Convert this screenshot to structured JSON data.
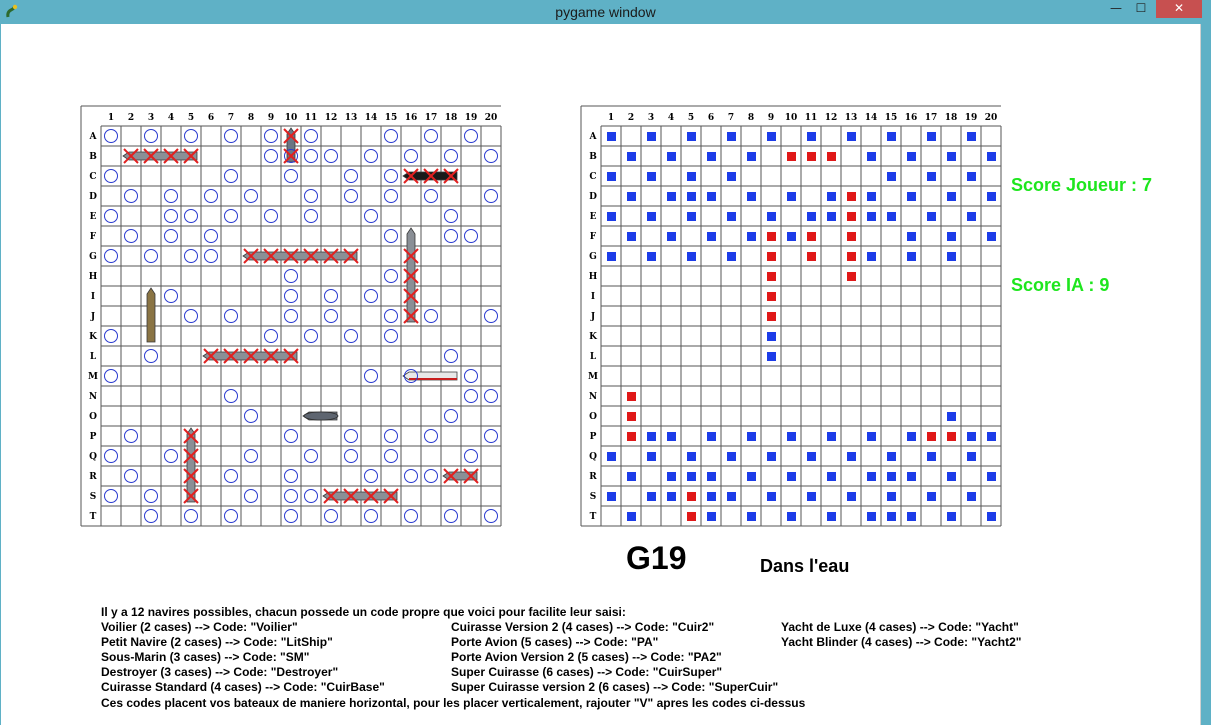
{
  "window": {
    "title": "pygame window",
    "minimize_glyph": "—",
    "maximize_glyph": "☐",
    "close_glyph": "✕",
    "frame_color": "#5fb1c6",
    "close_color": "#c75050"
  },
  "board": {
    "columns": [
      "1",
      "2",
      "3",
      "4",
      "5",
      "6",
      "7",
      "8",
      "9",
      "10",
      "11",
      "12",
      "13",
      "14",
      "15",
      "16",
      "17",
      "18",
      "19",
      "20"
    ],
    "rows": [
      "A",
      "B",
      "C",
      "D",
      "E",
      "F",
      "G",
      "H",
      "I",
      "J",
      "K",
      "L",
      "M",
      "N",
      "O",
      "P",
      "Q",
      "R",
      "S",
      "T"
    ]
  },
  "player_board": {
    "name": "player-board",
    "miss_marker": "blue-circle",
    "hit_marker": "red-cross",
    "misses": [
      "A1",
      "A3",
      "A5",
      "A7",
      "A9",
      "A11",
      "A15",
      "A17",
      "A19",
      "B9",
      "B10",
      "B11",
      "B12",
      "B14",
      "B16",
      "B18",
      "B20",
      "C1",
      "C7",
      "C10",
      "C13",
      "C15",
      "D2",
      "D4",
      "D6",
      "D8",
      "D11",
      "D13",
      "D15",
      "D17",
      "D20",
      "E1",
      "E4",
      "E5",
      "E7",
      "E9",
      "E11",
      "E14",
      "E18",
      "F2",
      "F4",
      "F6",
      "F15",
      "F18",
      "F19",
      "G1",
      "G3",
      "G5",
      "G6",
      "H10",
      "H15",
      "I4",
      "I10",
      "I12",
      "I14",
      "J5",
      "J7",
      "J10",
      "J12",
      "J15",
      "J17",
      "J20",
      "K1",
      "K9",
      "K11",
      "K13",
      "K15",
      "L3",
      "L18",
      "M1",
      "M14",
      "M16",
      "M19",
      "N7",
      "N19",
      "N20",
      "O8",
      "O18",
      "P2",
      "P10",
      "P13",
      "P15",
      "P17",
      "P20",
      "Q1",
      "Q4",
      "Q8",
      "Q11",
      "Q13",
      "Q15",
      "Q19",
      "R2",
      "R7",
      "R10",
      "R14",
      "R16",
      "R17",
      "S1",
      "S3",
      "S8",
      "S10",
      "S11",
      "T3",
      "T5",
      "T7",
      "T10",
      "T12",
      "T14",
      "T16",
      "T18",
      "T20"
    ],
    "hits": [
      "A10",
      "B2",
      "B3",
      "B4",
      "B5",
      "B10",
      "C16",
      "C17",
      "C18",
      "G8",
      "G9",
      "G10",
      "G11",
      "G12",
      "G13",
      "G16",
      "H16",
      "I16",
      "J16",
      "L6",
      "L7",
      "L8",
      "L9",
      "L10",
      "P5",
      "Q5",
      "R5",
      "S5",
      "R18",
      "R19",
      "S12",
      "S13",
      "S14",
      "S15"
    ],
    "ships": [
      {
        "name": "vertical-ship-col10",
        "icon": "navy-ship-icon",
        "cells": [
          "A10",
          "B10"
        ]
      },
      {
        "name": "horizontal-ship-row-b",
        "icon": "gray-ship-icon",
        "cells": [
          "B2",
          "B3",
          "B4",
          "B5"
        ]
      },
      {
        "name": "black-destroyer",
        "icon": "black-ship-icon",
        "cells": [
          "C16",
          "C17",
          "C18"
        ]
      },
      {
        "name": "horizontal-ship-row-g",
        "icon": "gray-ship-icon",
        "cells": [
          "G8",
          "G9",
          "G10",
          "G11",
          "G12",
          "G13"
        ]
      },
      {
        "name": "vertical-ship-col16",
        "icon": "gray-ship-icon",
        "cells": [
          "F16",
          "G16",
          "H16",
          "I16",
          "J16"
        ]
      },
      {
        "name": "brown-sailboat",
        "icon": "sailboat-icon",
        "cells": [
          "I3",
          "J3",
          "K3"
        ]
      },
      {
        "name": "horizontal-ship-row-l",
        "icon": "gray-ship-icon",
        "cells": [
          "L6",
          "L7",
          "L8",
          "L9",
          "L10"
        ]
      },
      {
        "name": "red-yacht",
        "icon": "yacht-icon",
        "cells": [
          "M16",
          "M17",
          "M18"
        ]
      },
      {
        "name": "submarine",
        "icon": "submarine-icon",
        "cells": [
          "O11",
          "O12"
        ]
      },
      {
        "name": "vertical-ship-col5",
        "icon": "gray-ship-icon",
        "cells": [
          "P5",
          "Q5",
          "R5",
          "S5"
        ]
      },
      {
        "name": "small-ship-row-r",
        "icon": "gray-ship-icon",
        "cells": [
          "R18",
          "R19"
        ]
      },
      {
        "name": "horizontal-ship-row-s",
        "icon": "gray-ship-icon",
        "cells": [
          "S12",
          "S13",
          "S14",
          "S15"
        ]
      }
    ]
  },
  "ia_board": {
    "name": "ia-board",
    "miss_marker": "blue-square",
    "hit_marker": "red-square",
    "misses": [
      "A1",
      "A3",
      "A5",
      "A7",
      "A9",
      "A11",
      "A13",
      "A15",
      "A17",
      "A19",
      "B2",
      "B4",
      "B6",
      "B8",
      "B14",
      "B16",
      "B18",
      "B20",
      "C1",
      "C3",
      "C5",
      "C7",
      "C15",
      "C17",
      "C19",
      "D2",
      "D4",
      "D5",
      "D6",
      "D8",
      "D10",
      "D12",
      "D14",
      "D16",
      "D18",
      "D20",
      "E1",
      "E3",
      "E5",
      "E7",
      "E9",
      "E11",
      "E12",
      "E14",
      "E15",
      "E17",
      "E19",
      "F2",
      "F4",
      "F6",
      "F8",
      "F10",
      "F16",
      "F18",
      "F20",
      "G1",
      "G3",
      "G5",
      "G7",
      "G14",
      "G16",
      "G18",
      "K9",
      "L9",
      "O18",
      "P3",
      "P4",
      "P6",
      "P8",
      "P10",
      "P12",
      "P14",
      "P16",
      "P19",
      "P20",
      "Q1",
      "Q3",
      "Q5",
      "Q7",
      "Q9",
      "Q11",
      "Q13",
      "Q15",
      "Q17",
      "Q19",
      "R2",
      "R4",
      "R5",
      "R6",
      "R8",
      "R10",
      "R12",
      "R14",
      "R15",
      "R16",
      "R18",
      "R20",
      "S1",
      "S3",
      "S4",
      "S6",
      "S7",
      "S9",
      "S11",
      "S13",
      "S15",
      "S17",
      "S19",
      "T2",
      "T6",
      "T8",
      "T10",
      "T12",
      "T14",
      "T15",
      "T16",
      "T18",
      "T20"
    ],
    "hits": [
      "B10",
      "B11",
      "B12",
      "D13",
      "E13",
      "F9",
      "F11",
      "F13",
      "G9",
      "G11",
      "G13",
      "H9",
      "H13",
      "I9",
      "J9",
      "N2",
      "O2",
      "P2",
      "P17",
      "P18",
      "S5",
      "T5"
    ]
  },
  "scores": {
    "player_label": "Score Joueur : 7",
    "ia_label": "Score IA : 9",
    "color": "#1ee61e"
  },
  "status": {
    "last_shot": "G19",
    "result": "Dans l'eau"
  },
  "info": {
    "intro": "Il y a 12 navires possibles, chacun possede un code propre que voici pour facilite leur saisi:",
    "col1": [
      "Voilier (2 cases) --> Code: \"Voilier\"",
      "Petit Navire (2 cases) --> Code: \"LitShip\"",
      "Sous-Marin (3 cases) --> Code: \"SM\"",
      "Destroyer (3 cases) --> Code: \"Destroyer\"",
      "Cuirasse Standard (4 cases) --> Code: \"CuirBase\""
    ],
    "col2": [
      "Cuirasse Version 2 (4 cases) --> Code: \"Cuir2\"",
      "Porte Avion (5 cases) --> Code: \"PA\"",
      "Porte Avion Version 2 (5 cases) --> Code: \"PA2\"",
      "Super Cuirasse (6 cases) --> Code: \"CuirSuper\"",
      "Super Cuirasse version 2 (6 cases) --> Code: \"SuperCuir\""
    ],
    "col3": [
      "Yacht de Luxe (4 cases) --> Code: \"Yacht\"",
      "Yacht Blinder (4 cases) --> Code: \"Yacht2\""
    ],
    "footer": "Ces codes placent vos bateaux de maniere horizontal, pour les placer verticalement, rajouter \"V\" apres les codes ci-dessus"
  }
}
